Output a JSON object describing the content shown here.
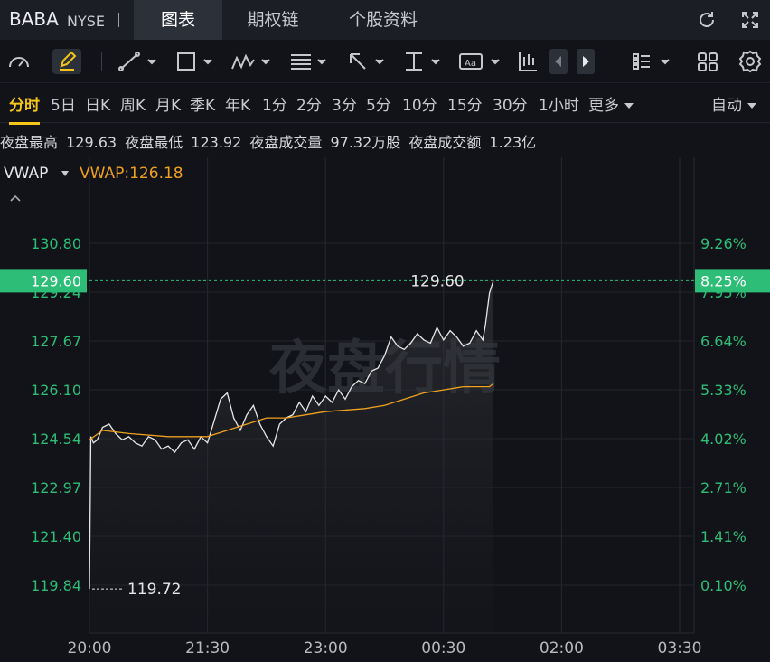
{
  "header": {
    "ticker": "BABA",
    "exchange": "NYSE",
    "tabs": [
      {
        "label": "图表",
        "active": true
      },
      {
        "label": "期权链",
        "active": false
      },
      {
        "label": "个股资料",
        "active": false
      }
    ],
    "right_icons": [
      "refresh-icon",
      "fullscreen-icon"
    ]
  },
  "toolbar": {
    "tools": [
      "gauge-icon",
      "pencil-icon",
      "line-tool-icon",
      "rectangle-tool-icon",
      "pattern-tool-icon",
      "fib-tool-icon",
      "arrow-tool-icon",
      "measure-tool-icon",
      "text-tool-icon",
      "candle-tool-icon",
      "prev-icon",
      "next-icon",
      "list-icon",
      "grid-icon",
      "settings-icon"
    ],
    "text_tool_label": "Aa"
  },
  "periods": {
    "items": [
      "分时",
      "5日",
      "日K",
      "周K",
      "月K",
      "季K",
      "年K",
      "1分",
      "2分",
      "3分",
      "5分",
      "10分",
      "15分",
      "30分",
      "1小时",
      "更多"
    ],
    "active": "分时",
    "auto_label": "自动"
  },
  "stats": {
    "high_label": "夜盘最高",
    "high_value": "129.63",
    "low_label": "夜盘最低",
    "low_value": "123.92",
    "volume_label": "夜盘成交量",
    "volume_value": "97.32万股",
    "amount_label": "夜盘成交额",
    "amount_value": "1.23亿"
  },
  "indicator": {
    "name": "VWAP",
    "value_text": "VWAP:126.18"
  },
  "chart_data": {
    "type": "line",
    "watermark": "夜盘行情",
    "price_ticks": [
      "130.80",
      "129.24",
      "127.67",
      "126.10",
      "124.54",
      "122.97",
      "121.40",
      "119.84"
    ],
    "percent_ticks": [
      "9.26%",
      "7.95%",
      "6.64%",
      "5.33%",
      "4.02%",
      "2.71%",
      "1.41%",
      "0.10%"
    ],
    "x_ticks": [
      "20:00",
      "21:30",
      "23:00",
      "00:30",
      "02:00",
      "03:30"
    ],
    "last_price_label": "129.60",
    "last_percent_label": "8.25%",
    "last_price_annotation": "129.60",
    "low_annotation": "119.72",
    "ylim": [
      119.84,
      130.8
    ],
    "colors": {
      "price": "#e6e6e6",
      "vwap": "#f0a020",
      "axis_green": "#2ebd76",
      "badge": "#2ebd76"
    },
    "series": [
      {
        "name": "price",
        "times": [
          "20:00",
          "20:01",
          "20:03",
          "20:06",
          "20:10",
          "20:15",
          "20:20",
          "20:25",
          "20:30",
          "20:35",
          "20:40",
          "20:45",
          "20:50",
          "20:55",
          "21:00",
          "21:05",
          "21:10",
          "21:15",
          "21:20",
          "21:25",
          "21:30",
          "21:35",
          "21:40",
          "21:45",
          "21:50",
          "21:55",
          "22:00",
          "22:05",
          "22:10",
          "22:15",
          "22:20",
          "22:25",
          "22:30",
          "22:35",
          "22:40",
          "22:45",
          "22:50",
          "22:55",
          "23:00",
          "23:05",
          "23:10",
          "23:15",
          "23:20",
          "23:25",
          "23:30",
          "23:35",
          "23:40",
          "23:45",
          "23:50",
          "23:55",
          "00:00",
          "00:05",
          "00:10",
          "00:15",
          "00:20",
          "00:25",
          "00:30",
          "00:35",
          "00:40",
          "00:45",
          "00:50",
          "00:55",
          "01:00",
          "01:02",
          "01:05",
          "01:08"
        ],
        "values": [
          119.72,
          124.6,
          124.4,
          124.5,
          124.9,
          125.0,
          124.7,
          124.5,
          124.6,
          124.4,
          124.3,
          124.6,
          124.5,
          124.2,
          124.3,
          124.1,
          124.4,
          124.5,
          124.2,
          124.6,
          124.4,
          125.1,
          125.8,
          126.0,
          125.2,
          124.8,
          125.3,
          125.6,
          125.0,
          124.6,
          124.3,
          125.0,
          125.2,
          125.3,
          125.7,
          125.4,
          125.9,
          125.6,
          125.9,
          125.7,
          126.1,
          125.8,
          126.2,
          126.4,
          126.3,
          126.7,
          126.8,
          127.2,
          127.8,
          127.5,
          127.4,
          127.6,
          127.9,
          127.7,
          127.6,
          128.1,
          127.7,
          128.0,
          127.8,
          127.5,
          127.6,
          128.0,
          127.7,
          128.2,
          129.2,
          129.6
        ]
      },
      {
        "name": "vwap",
        "times": [
          "20:00",
          "20:10",
          "20:30",
          "21:00",
          "21:30",
          "21:45",
          "22:00",
          "22:15",
          "22:30",
          "22:45",
          "23:00",
          "23:30",
          "23:45",
          "00:00",
          "00:15",
          "00:30",
          "00:45",
          "01:00",
          "01:05",
          "01:08"
        ],
        "values": [
          124.5,
          124.8,
          124.7,
          124.6,
          124.6,
          124.8,
          125.0,
          125.2,
          125.2,
          125.3,
          125.4,
          125.5,
          125.6,
          125.8,
          126.0,
          126.1,
          126.2,
          126.2,
          126.2,
          126.3
        ]
      }
    ]
  }
}
